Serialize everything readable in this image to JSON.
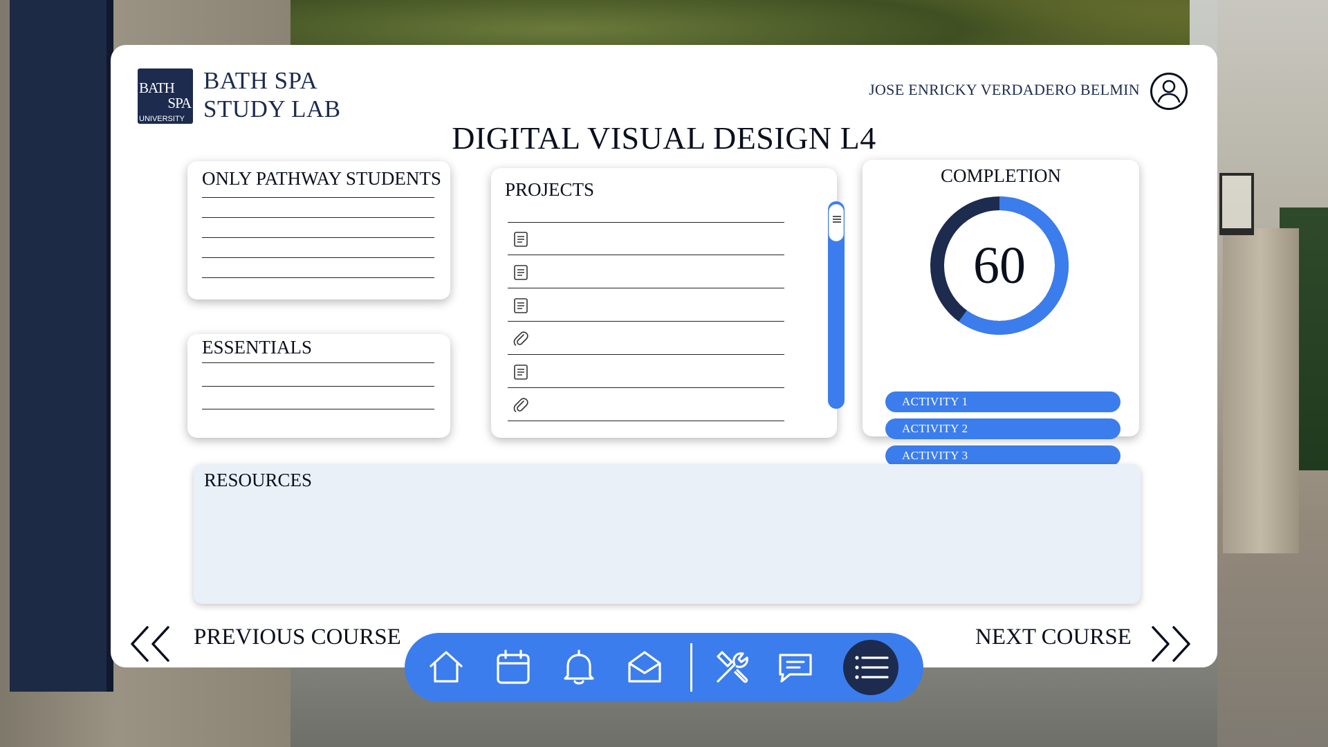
{
  "brand": {
    "logo_line1": "BATH",
    "logo_line2": "SPA",
    "logo_line3": "UNIVERSITY",
    "name": "BATH SPA STUDY LAB"
  },
  "user": {
    "name": "JOSE ENRICKY VERDADERO BELMIN",
    "icon": "user-avatar-icon"
  },
  "course_title": "DIGITAL VISUAL DESIGN L4",
  "pathway_card": {
    "title": "ONLY PATHWAY STUDENTS"
  },
  "essentials_card": {
    "title": "ESSENTIALS"
  },
  "projects": {
    "title": "PROJECTS",
    "items": [
      {
        "icon": "document-icon"
      },
      {
        "icon": "document-icon"
      },
      {
        "icon": "document-icon"
      },
      {
        "icon": "paperclip-icon"
      },
      {
        "icon": "document-icon"
      },
      {
        "icon": "paperclip-icon"
      }
    ]
  },
  "completion": {
    "title": "COMPLETION",
    "value": "60",
    "percent": 60,
    "activities": [
      "ACTIVITY 1",
      "ACTIVITY 2",
      "ACTIVITY 3"
    ]
  },
  "resources": {
    "title": "RESOURCES"
  },
  "navigation": {
    "previous_label": "PREVIOUS COURSE",
    "next_label": "NEXT COURSE"
  },
  "dock": {
    "items": [
      "home-icon",
      "calendar-icon",
      "bell-icon",
      "mail-icon",
      "tools-icon",
      "chat-icon",
      "menu-icon"
    ]
  },
  "colors": {
    "accent": "#3b7ded",
    "navy": "#1c2b4e",
    "resources_bg": "#e9f0f8"
  }
}
